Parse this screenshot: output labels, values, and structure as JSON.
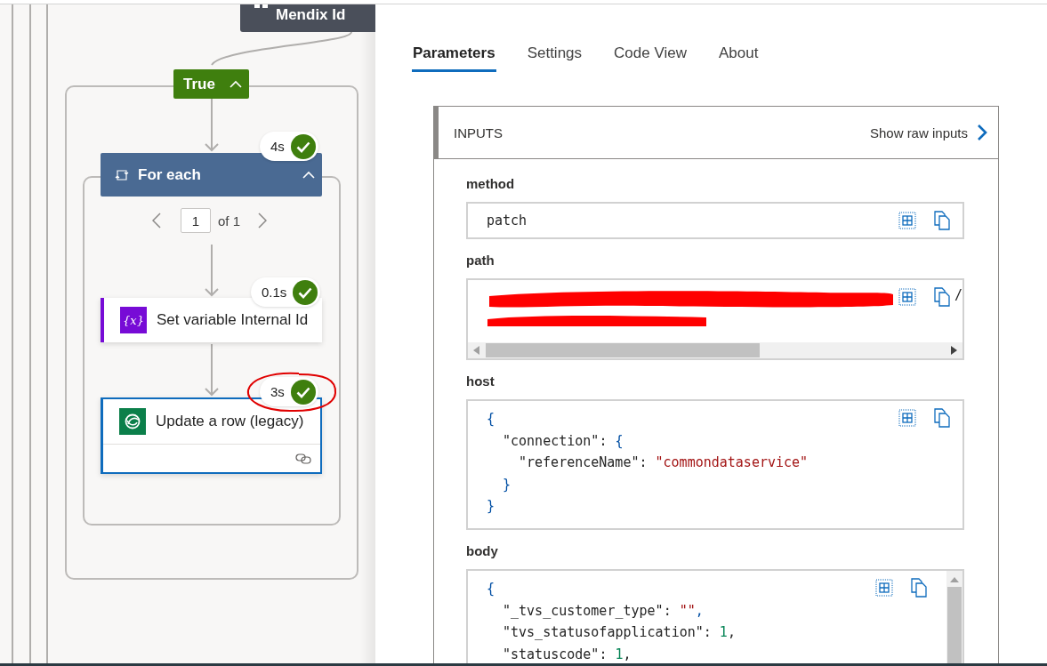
{
  "flow": {
    "top_node": {
      "title": "Mendix Id"
    },
    "condition": {
      "label": "True",
      "expanded": true
    },
    "loop": {
      "title": "For each",
      "expanded": true,
      "duration": "4s",
      "succeeded": true,
      "pager": {
        "current": "1",
        "total": "of 1"
      }
    },
    "actions": [
      {
        "kind": "variable",
        "icon_label": "{x}",
        "title": "Set variable Internal Id",
        "duration": "0.1s",
        "succeeded": true,
        "selected": false,
        "annotated": false
      },
      {
        "kind": "dataverse",
        "title": "Update a row (legacy)",
        "duration": "3s",
        "succeeded": true,
        "selected": true,
        "annotated": true
      }
    ]
  },
  "panel": {
    "tabs": [
      {
        "label": "Parameters",
        "selected": true
      },
      {
        "label": "Settings",
        "selected": false
      },
      {
        "label": "Code View",
        "selected": false
      },
      {
        "label": "About",
        "selected": false
      }
    ],
    "inputs": {
      "title": "INPUTS",
      "raw_link": "Show raw inputs",
      "params": [
        {
          "name": "method",
          "kind": "text",
          "value": "patch"
        },
        {
          "name": "path",
          "kind": "redacted",
          "value": "/"
        },
        {
          "name": "host",
          "kind": "json",
          "lines": [
            [
              {
                "kind": "brace",
                "text": "{"
              }
            ],
            [
              {
                "kind": "key",
                "text": "\"connection\""
              },
              {
                "kind": "plain",
                "text": ": "
              },
              {
                "kind": "brace",
                "text": "{"
              }
            ],
            [
              {
                "kind": "key",
                "text": "\"referenceName\""
              },
              {
                "kind": "plain",
                "text": ": "
              },
              {
                "kind": "string",
                "text": "\"commondataservice\""
              }
            ],
            [
              {
                "kind": "brace",
                "text": "}"
              }
            ],
            [
              {
                "kind": "brace",
                "text": "}"
              }
            ]
          ]
        },
        {
          "name": "body",
          "kind": "json",
          "lines": [
            [
              {
                "kind": "brace",
                "text": "{"
              }
            ],
            [
              {
                "kind": "key",
                "text": "\"_tvs_customer_type\""
              },
              {
                "kind": "plain",
                "text": ": "
              },
              {
                "kind": "string",
                "text": "\"\""
              },
              {
                "kind": "brace",
                "text": ","
              }
            ],
            [
              {
                "kind": "key",
                "text": "\"tvs_statusofapplication\""
              },
              {
                "kind": "plain",
                "text": ": "
              },
              {
                "kind": "number",
                "text": "1"
              },
              {
                "kind": "plain",
                "text": ","
              }
            ],
            [
              {
                "kind": "key",
                "text": "\"statuscode\""
              },
              {
                "kind": "plain",
                "text": ": "
              },
              {
                "kind": "number",
                "text": "1"
              },
              {
                "kind": "plain",
                "text": ","
              }
            ]
          ]
        }
      ]
    }
  }
}
